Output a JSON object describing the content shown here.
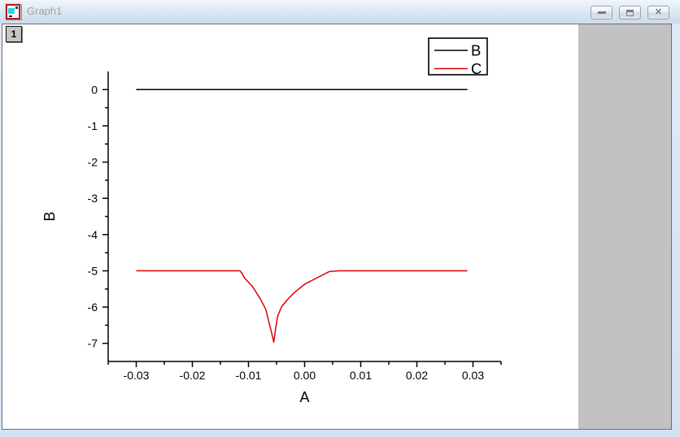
{
  "window": {
    "title": "Graph1",
    "layer_button": "1",
    "controls": [
      {
        "name": "minimize-button",
        "icon": "minimize-icon"
      },
      {
        "name": "restore-button",
        "icon": "restore-icon"
      },
      {
        "name": "close-button",
        "icon": "close-icon",
        "glyph": "✕"
      }
    ]
  },
  "colors": {
    "titlebar_text": "#a3a3a3",
    "frame_blue": "#d7e5f4",
    "client_bg": "#c2c2c2",
    "page_bg": "#ffffff",
    "axis_color": "#000000",
    "series_b_color": "#000000",
    "series_c_color": "#dd0000"
  },
  "chart_data": {
    "type": "line",
    "title": "",
    "xlabel": "A",
    "ylabel": "B",
    "xlim": [
      -0.035,
      0.035
    ],
    "ylim": [
      -7.5,
      0.5
    ],
    "grid": false,
    "axes_style": "L-shape, ticks outward, no top/right frame",
    "x_major_ticks": [
      -0.03,
      -0.02,
      -0.01,
      0.0,
      0.01,
      0.02,
      0.03
    ],
    "x_tick_labels": [
      "-0.03",
      "-0.02",
      "-0.01",
      "0.00",
      "0.01",
      "0.02",
      "0.03"
    ],
    "x_minor_ticks": [
      -0.035,
      -0.025,
      -0.015,
      -0.005,
      0.005,
      0.015,
      0.025,
      0.035
    ],
    "y_major_ticks": [
      0,
      -1,
      -2,
      -3,
      -4,
      -5,
      -6,
      -7
    ],
    "y_tick_labels": [
      "0",
      "-1",
      "-2",
      "-3",
      "-4",
      "-5",
      "-6",
      "-7"
    ],
    "y_minor_ticks": [
      -0.5,
      -1.5,
      -2.5,
      -3.5,
      -4.5,
      -5.5,
      -6.5
    ],
    "legend": {
      "position": "top-right",
      "entries": [
        {
          "label": "B",
          "color": "#000000"
        },
        {
          "label": "C",
          "color": "#dd0000"
        }
      ]
    },
    "series": [
      {
        "name": "B",
        "color": "#000000",
        "points": [
          [
            -0.03,
            0.0
          ],
          [
            0.029,
            0.0
          ]
        ]
      },
      {
        "name": "C",
        "color": "#dd0000",
        "points": [
          [
            -0.03,
            -5.0
          ],
          [
            -0.0115,
            -5.0
          ],
          [
            -0.0111,
            -5.08
          ],
          [
            -0.0107,
            -5.2
          ],
          [
            -0.0093,
            -5.43
          ],
          [
            -0.0079,
            -5.77
          ],
          [
            -0.0069,
            -6.07
          ],
          [
            -0.0065,
            -6.33
          ],
          [
            -0.0059,
            -6.7
          ],
          [
            -0.0055,
            -6.97
          ],
          [
            -0.0052,
            -6.63
          ],
          [
            -0.0048,
            -6.25
          ],
          [
            -0.0041,
            -5.99
          ],
          [
            -0.0031,
            -5.8
          ],
          [
            -0.0017,
            -5.58
          ],
          [
            0.0001,
            -5.36
          ],
          [
            0.0025,
            -5.17
          ],
          [
            0.0044,
            -5.02
          ],
          [
            0.0062,
            -5.0
          ],
          [
            0.029,
            -5.0
          ]
        ]
      }
    ]
  }
}
